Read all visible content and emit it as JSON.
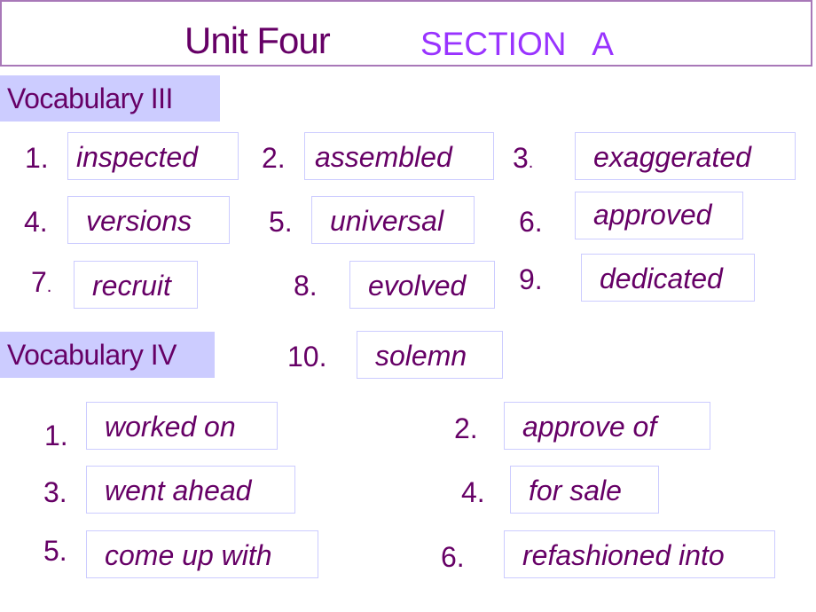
{
  "header": {
    "unit": "Unit Four",
    "section": "SECTION   A"
  },
  "colors": {
    "text": "#660066",
    "section_accent": "#9933ff",
    "label_bg": "#ccccff",
    "box_border": "#ccccff",
    "title_border": "#a878b8"
  },
  "vocab3": {
    "label": "Vocabulary III",
    "items": [
      {
        "num": "1.",
        "answer": "inspected"
      },
      {
        "num": "2.",
        "answer": "assembled"
      },
      {
        "num": "3.",
        "answer": "exaggerated"
      },
      {
        "num": "4.",
        "answer": "versions"
      },
      {
        "num": "5.",
        "answer": "universal"
      },
      {
        "num": "6.",
        "answer": "approved"
      },
      {
        "num": "7.",
        "answer": "recruit"
      },
      {
        "num": "8.",
        "answer": "evolved"
      },
      {
        "num": "9.",
        "answer": "dedicated"
      },
      {
        "num": "10.",
        "answer": "solemn"
      }
    ]
  },
  "vocab4": {
    "label": "Vocabulary IV",
    "items": [
      {
        "num": "1.",
        "answer": "worked on"
      },
      {
        "num": "2.",
        "answer": "approve of"
      },
      {
        "num": "3.",
        "answer": "went ahead"
      },
      {
        "num": "4.",
        "answer": "for sale"
      },
      {
        "num": "5.",
        "answer": "come up with"
      },
      {
        "num": "6.",
        "answer": "refashioned into"
      }
    ]
  }
}
